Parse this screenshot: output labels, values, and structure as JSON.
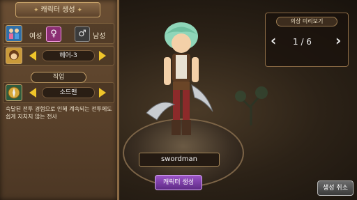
{
  "title": "캐릭터 생성",
  "gender": {
    "female_label": "여성",
    "male_label": "남성",
    "female_symbol": "♀",
    "male_symbol": "♂"
  },
  "hair": {
    "value": "헤어-3"
  },
  "job": {
    "header": "직업",
    "value": "소드맨",
    "description": "숙달된 전투 경험으로 인해 계속되는 전투에도 쉽게 지치지 않는 전사"
  },
  "costume_preview": {
    "label": "의상 미리보기",
    "page": "1 / 6"
  },
  "character_name": "swordman",
  "buttons": {
    "create": "캐릭터 생성",
    "cancel": "생성 취소"
  },
  "colors": {
    "arrow": "#f0c52a",
    "create_button": "#7a3ea8",
    "female_selected": "#c84fae"
  }
}
